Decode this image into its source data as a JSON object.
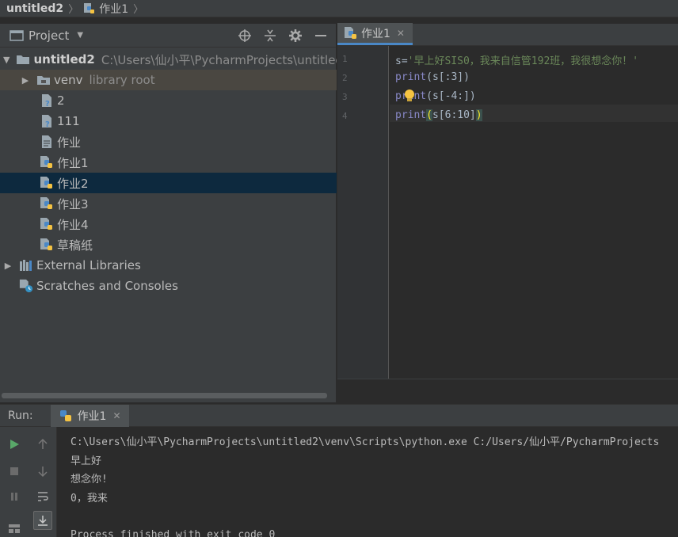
{
  "breadcrumb": {
    "root": "untitled2",
    "file": "作业1"
  },
  "project": {
    "title": "Project",
    "tree": [
      {
        "label": "untitled2",
        "extra": "C:\\Users\\仙小平\\PycharmProjects\\untitled",
        "type": "project-root",
        "expanded": true
      },
      {
        "label": "venv",
        "extra": "library root",
        "type": "folder",
        "expanded": false
      },
      {
        "label": "2",
        "type": "unknown-file"
      },
      {
        "label": "111",
        "type": "unknown-file"
      },
      {
        "label": "作业",
        "type": "text-file"
      },
      {
        "label": "作业1",
        "type": "python-file"
      },
      {
        "label": "作业2",
        "type": "python-file",
        "selected": true
      },
      {
        "label": "作业3",
        "type": "python-file"
      },
      {
        "label": "作业4",
        "type": "python-file"
      },
      {
        "label": "草稿纸",
        "type": "python-file"
      },
      {
        "label": "External Libraries",
        "type": "libraries",
        "expanded": false
      },
      {
        "label": "Scratches and Consoles",
        "type": "scratches"
      }
    ]
  },
  "editor": {
    "tab": "作业1",
    "line_numbers": [
      "1",
      "2",
      "3",
      "4"
    ],
    "lines": {
      "l1_var": "s=",
      "l1_str": "'早上好SIS0，我来自信管192班，我很想念你！'",
      "l2_kw": "print",
      "l2_rest": "(s[:3])",
      "l3_kw": "print",
      "l3_rest": "(s[-4:])",
      "l4_kw": "print",
      "l4_open": "(",
      "l4_rest": "s[6:10]",
      "l4_close": ")"
    }
  },
  "run": {
    "label": "Run:",
    "tab": "作业1",
    "output": [
      "C:\\Users\\仙小平\\PycharmProjects\\untitled2\\venv\\Scripts\\python.exe C:/Users/仙小平/PycharmProjects",
      "早上好",
      "想念你!",
      "0，我来",
      "",
      "Process finished with exit code 0"
    ]
  },
  "colors": {
    "python_blue": "#4a88c7",
    "python_yellow": "#f5c342",
    "run_green": "#59a869"
  }
}
